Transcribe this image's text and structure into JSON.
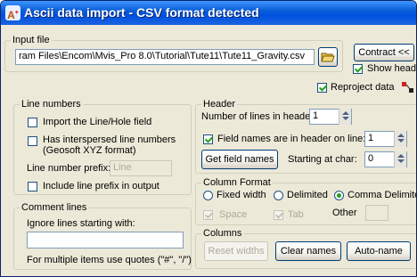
{
  "window": {
    "title": "Ascii data import - CSV format detected",
    "icon_text": "A"
  },
  "input_file": {
    "legend": "Input file",
    "path": "ram Files\\Encom\\Mvis_Pro 8.0\\Tutorial\\Tute11\\Tute11_Gravity.csv",
    "browse_icon": "folder-open-icon",
    "contract_label": "Contract <<",
    "show_header_label": "Show heade",
    "show_header_checked": true,
    "reproject_label": "Reproject data",
    "reproject_checked": true,
    "reproject_icon": "reproject-icon"
  },
  "line_numbers": {
    "legend": "Line numbers",
    "import_label": "Import the Line/Hole field",
    "import_checked": false,
    "interspersed_label_1": "Has interspersed line numbers",
    "interspersed_label_2": "(Geosoft XYZ format)",
    "interspersed_checked": false,
    "prefix_label": "Line number prefix:",
    "prefix_value": "Line",
    "include_prefix_label": "Include line prefix in output",
    "include_prefix_checked": false
  },
  "comment_lines": {
    "legend": "Comment lines",
    "ignore_label": "Ignore lines starting with:",
    "ignore_value": "",
    "hint": "For multiple items use quotes (\"#\", \"/\")"
  },
  "header": {
    "legend": "Header",
    "lines_label": "Number of lines in header",
    "lines_value": "1",
    "field_names_label": "Field names are in header on line:",
    "field_names_checked": true,
    "field_names_line": "1",
    "get_field_names_label": "Get field names",
    "starting_label": "Starting at char:",
    "starting_value": "0"
  },
  "column_format": {
    "legend": "Column Format",
    "options": [
      "Fixed width",
      "Delimited",
      "Comma Delimited"
    ],
    "selected": "Comma Delimited",
    "space_label": "Space",
    "space_checked": true,
    "tab_label": "Tab",
    "tab_checked": true,
    "other_label": "Other",
    "other_value": ""
  },
  "columns": {
    "legend": "Columns",
    "reset_label": "Reset widths",
    "clear_label": "Clear names",
    "autoname_label": "Auto-name"
  }
}
